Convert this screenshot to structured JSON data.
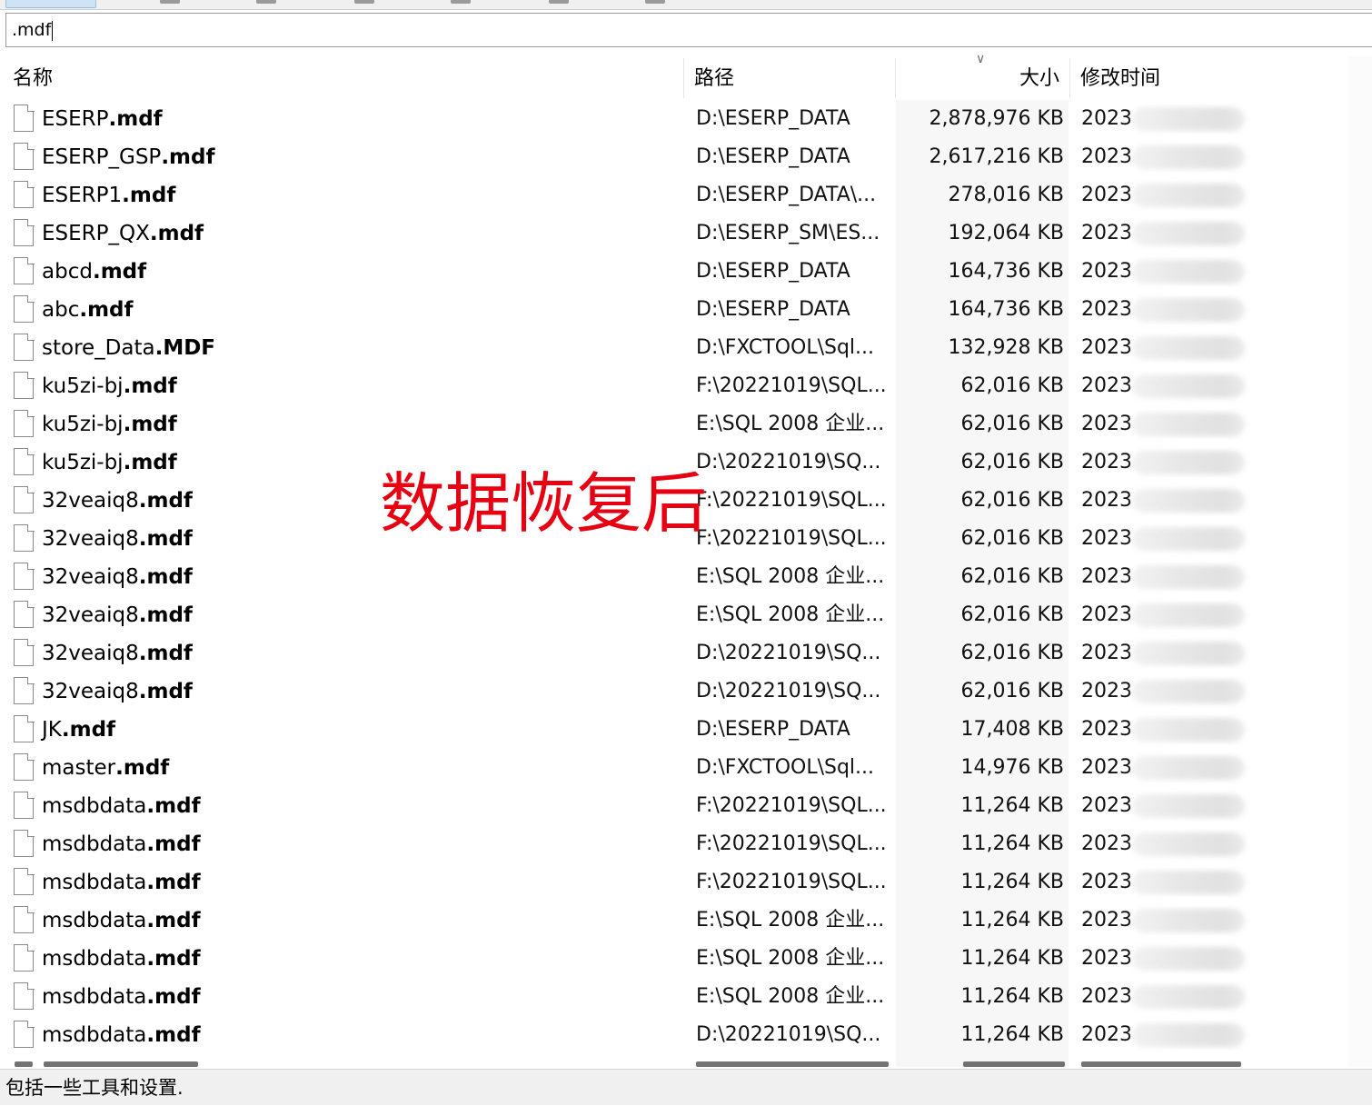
{
  "search": {
    "value": ".mdf"
  },
  "columns": {
    "name": "名称",
    "path": "路径",
    "size": "大小",
    "modified": "修改时间"
  },
  "sort_indicator_icon": "chevron-down-icon",
  "overlay_text": "数据恢复后",
  "overlay_color": "#e60012",
  "rows": [
    {
      "base": "ESERP",
      "ext": ".mdf",
      "path": "D:\\ESERP_DATA",
      "size": "2,878,976 KB",
      "time": "2023"
    },
    {
      "base": "ESERP_GSP",
      "ext": ".mdf",
      "path": "D:\\ESERP_DATA",
      "size": "2,617,216 KB",
      "time": "2023"
    },
    {
      "base": "ESERP1",
      "ext": ".mdf",
      "path": "D:\\ESERP_DATA\\...",
      "size": "278,016 KB",
      "time": "2023"
    },
    {
      "base": "ESERP_QX",
      "ext": ".mdf",
      "path": "D:\\ESERP_SM\\ES...",
      "size": "192,064 KB",
      "time": "2023"
    },
    {
      "base": "abcd",
      "ext": ".mdf",
      "path": "D:\\ESERP_DATA",
      "size": "164,736 KB",
      "time": "2023"
    },
    {
      "base": "abc",
      "ext": ".mdf",
      "path": "D:\\ESERP_DATA",
      "size": "164,736 KB",
      "time": "2023"
    },
    {
      "base": "store_Data",
      "ext": ".MDF",
      "path": "D:\\FXCTOOL\\Sql...",
      "size": "132,928 KB",
      "time": "2023"
    },
    {
      "base": "ku5zi-bj",
      "ext": ".mdf",
      "path": "F:\\20221019\\SQL...",
      "size": "62,016 KB",
      "time": "2023"
    },
    {
      "base": "ku5zi-bj",
      "ext": ".mdf",
      "path": "E:\\SQL 2008 企业...",
      "size": "62,016 KB",
      "time": "2023"
    },
    {
      "base": "ku5zi-bj",
      "ext": ".mdf",
      "path": "D:\\20221019\\SQ...",
      "size": "62,016 KB",
      "time": "2023"
    },
    {
      "base": "32veaiq8",
      "ext": ".mdf",
      "path": "F:\\20221019\\SQL...",
      "size": "62,016 KB",
      "time": "2023"
    },
    {
      "base": "32veaiq8",
      "ext": ".mdf",
      "path": "F:\\20221019\\SQL...",
      "size": "62,016 KB",
      "time": "2023"
    },
    {
      "base": "32veaiq8",
      "ext": ".mdf",
      "path": "E:\\SQL 2008 企业...",
      "size": "62,016 KB",
      "time": "2023"
    },
    {
      "base": "32veaiq8",
      "ext": ".mdf",
      "path": "E:\\SQL 2008 企业...",
      "size": "62,016 KB",
      "time": "2023"
    },
    {
      "base": "32veaiq8",
      "ext": ".mdf",
      "path": "D:\\20221019\\SQ...",
      "size": "62,016 KB",
      "time": "2023"
    },
    {
      "base": "32veaiq8",
      "ext": ".mdf",
      "path": "D:\\20221019\\SQ...",
      "size": "62,016 KB",
      "time": "2023"
    },
    {
      "base": "JK",
      "ext": ".mdf",
      "path": "D:\\ESERP_DATA",
      "size": "17,408 KB",
      "time": "2023"
    },
    {
      "base": "master",
      "ext": ".mdf",
      "path": "D:\\FXCTOOL\\Sql...",
      "size": "14,976 KB",
      "time": "2023"
    },
    {
      "base": "msdbdata",
      "ext": ".mdf",
      "path": "F:\\20221019\\SQL...",
      "size": "11,264 KB",
      "time": "2023"
    },
    {
      "base": "msdbdata",
      "ext": ".mdf",
      "path": "F:\\20221019\\SQL...",
      "size": "11,264 KB",
      "time": "2023"
    },
    {
      "base": "msdbdata",
      "ext": ".mdf",
      "path": "F:\\20221019\\SQL...",
      "size": "11,264 KB",
      "time": "2023"
    },
    {
      "base": "msdbdata",
      "ext": ".mdf",
      "path": "E:\\SQL 2008 企业...",
      "size": "11,264 KB",
      "time": "2023"
    },
    {
      "base": "msdbdata",
      "ext": ".mdf",
      "path": "E:\\SQL 2008 企业...",
      "size": "11,264 KB",
      "time": "2023"
    },
    {
      "base": "msdbdata",
      "ext": ".mdf",
      "path": "E:\\SQL 2008 企业...",
      "size": "11,264 KB",
      "time": "2023"
    },
    {
      "base": "msdbdata",
      "ext": ".mdf",
      "path": "D:\\20221019\\SQ...",
      "size": "11,264 KB",
      "time": "2023"
    }
  ],
  "status": {
    "text": "包括一些工具和设置."
  }
}
